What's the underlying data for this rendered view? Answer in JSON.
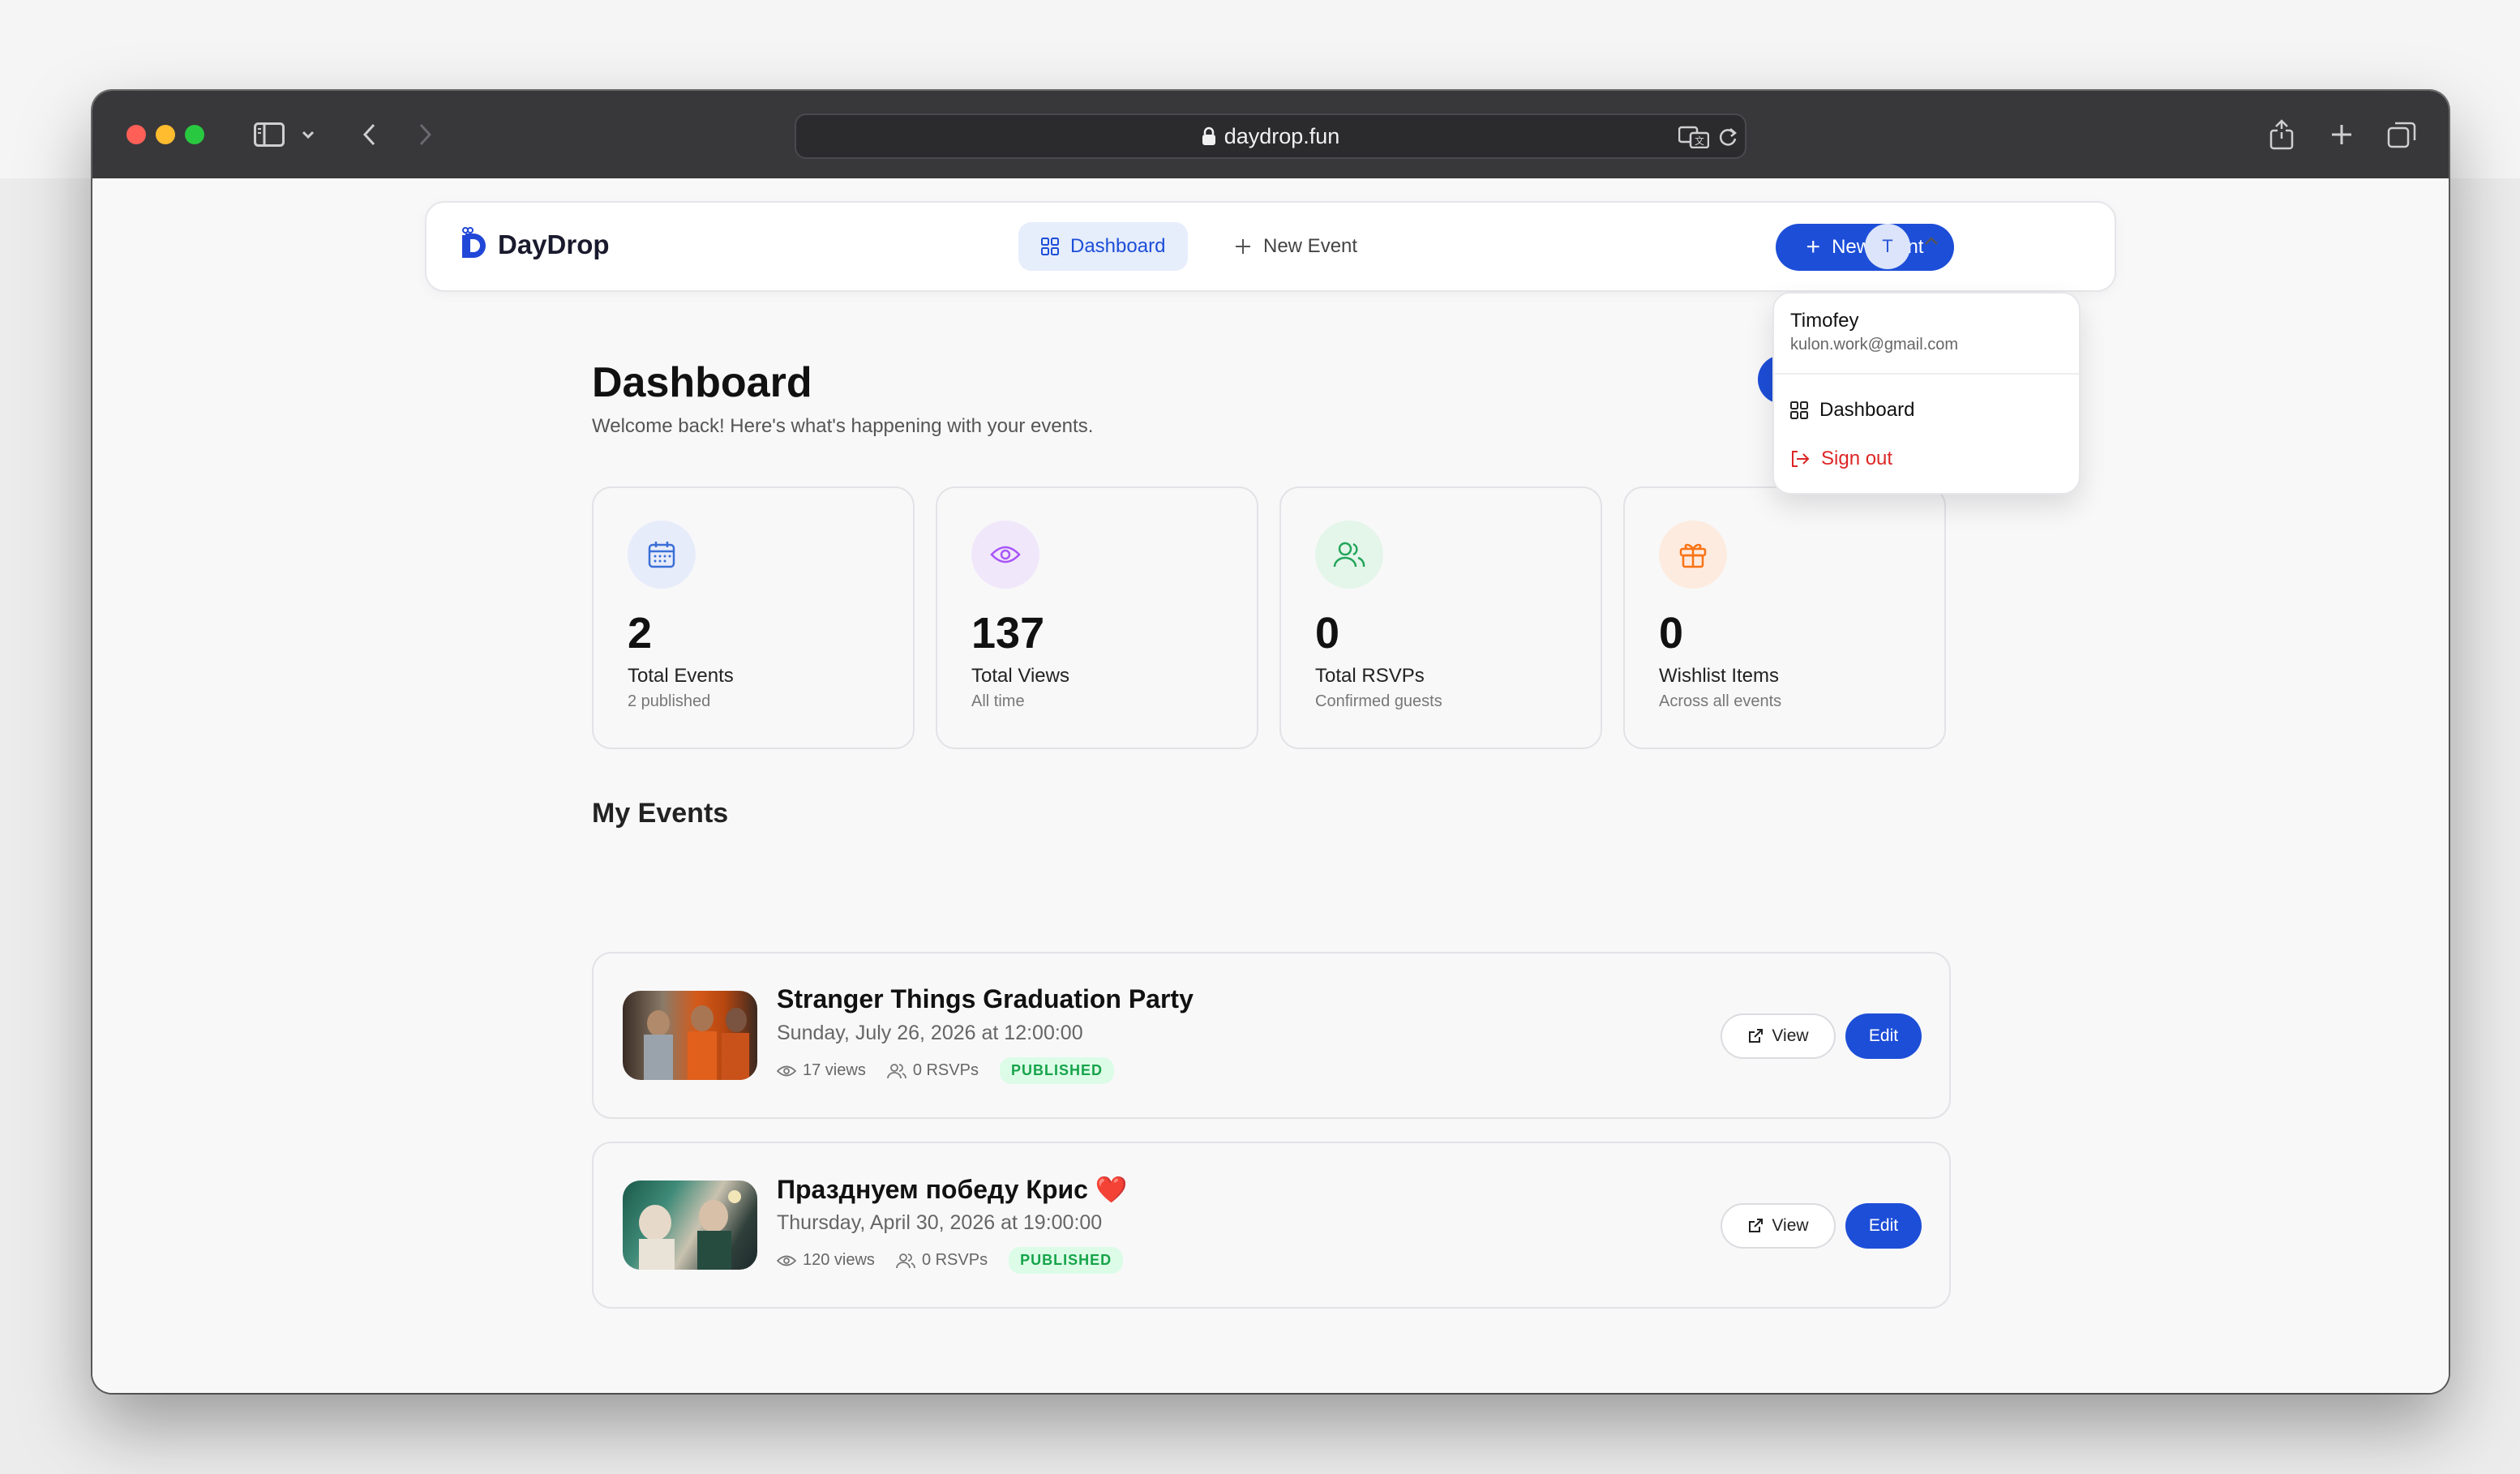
{
  "browser": {
    "url": "daydrop.fun"
  },
  "navbar": {
    "logo_text": "DayDrop",
    "tabs": [
      {
        "label": "Dashboard",
        "icon": "grid-icon",
        "active": true
      },
      {
        "label": "New Event",
        "icon": "plus-icon",
        "active": false
      }
    ],
    "new_event_button": "New event",
    "avatar_initial": "T"
  },
  "user_menu": {
    "name": "Timofey",
    "email": "kulon.work@gmail.com",
    "items": [
      {
        "label": "Dashboard",
        "icon": "grid-icon"
      },
      {
        "label": "Sign out",
        "icon": "sign-out-icon",
        "color": "#dc2626"
      }
    ]
  },
  "page": {
    "title": "Dashboard",
    "subtitle": "Welcome back! Here's what's happening with your events."
  },
  "stats": [
    {
      "value": "2",
      "label": "Total Events",
      "sub": "2 published",
      "icon": "calendar-icon",
      "color": "#3b6fd6",
      "bg": "#e7ecfa"
    },
    {
      "value": "137",
      "label": "Total Views",
      "sub": "All time",
      "icon": "eye-icon",
      "color": "#a855f7",
      "bg": "#f1e7fb"
    },
    {
      "value": "0",
      "label": "Total RSVPs",
      "sub": "Confirmed guests",
      "icon": "users-icon",
      "color": "#22a55a",
      "bg": "#e4f5ea"
    },
    {
      "value": "0",
      "label": "Wishlist Items",
      "sub": "Across all events",
      "icon": "gift-icon",
      "color": "#f97316",
      "bg": "#fdebdf"
    }
  ],
  "events_section": {
    "title": "My Events",
    "events": [
      {
        "title": "Stranger Things Graduation Party",
        "date": "Sunday, July 26, 2026 at 12:00:00",
        "views": "17 views",
        "rsvps": "0 RSVPs",
        "status": "PUBLISHED",
        "view_label": "View",
        "edit_label": "Edit"
      },
      {
        "title": "Празднуем победу Крис ❤️",
        "date": "Thursday, April 30, 2026 at 19:00:00",
        "views": "120 views",
        "rsvps": "0 RSVPs",
        "status": "PUBLISHED",
        "view_label": "View",
        "edit_label": "Edit"
      }
    ]
  },
  "colors": {
    "accent": "#1d4ed8",
    "badge_bg": "#dcfce7",
    "badge_text": "#16a34a"
  }
}
